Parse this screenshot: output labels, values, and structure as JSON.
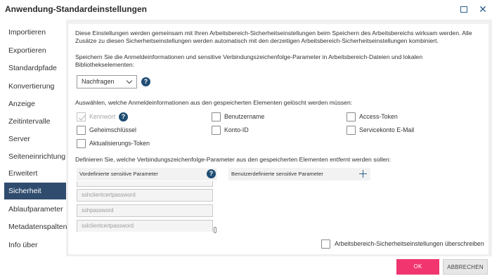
{
  "window": {
    "title": "Anwendung-Standardeinstellungen"
  },
  "sidebar": {
    "items": [
      {
        "label": "Importieren",
        "active": false
      },
      {
        "label": "Exportieren",
        "active": false
      },
      {
        "label": "Standardpfade",
        "active": false
      },
      {
        "label": "Konvertierung",
        "active": false
      },
      {
        "label": "Anzeige",
        "active": false
      },
      {
        "label": "Zeitintervalle",
        "active": false
      },
      {
        "label": "Server",
        "active": false
      },
      {
        "label": "Seiteneinrichtung",
        "active": false
      },
      {
        "label": "Erweitert",
        "active": false
      },
      {
        "label": "Sicherheit",
        "active": true
      },
      {
        "label": "Ablaufparameter",
        "active": false
      },
      {
        "label": "Metadatenspalten",
        "active": false
      },
      {
        "label": "Info über",
        "active": false
      }
    ]
  },
  "main": {
    "intro_line1": "Diese Einstellungen werden gemeinsam mit Ihren Arbeitsbereich-Sicherheitseinstellungen beim Speichern des Arbeitsbereichs wirksam werden.  Alle",
    "intro_line2": "Zusätze zu diesen Sicherheitseinstellungen werden automatisch mit den derzeitigen Arbeitsbereich-Sicherheitseinstellungen kombiniert.",
    "save_line1": "Speichern Sie die Anmeldeinformationen und sensitive Verbindungszeichenfolge-Parameter in Arbeitsbereich-Dateien und lokalen",
    "save_line2": "Bibliothekselementen:",
    "save_select_value": "Nachfragen",
    "credentials_prompt": "Auswählen, welche Anmeldeinformationen aus den gespeicherten Elementen gelöscht werden müssen:",
    "checkboxes": {
      "kennwort": {
        "label": "Kennwort",
        "checked": true,
        "disabled": true
      },
      "benutzername": {
        "label": "Benutzername",
        "checked": false
      },
      "access_token": {
        "label": "Access-Token",
        "checked": false
      },
      "geheimschluessel": {
        "label": "Geheimschlüssel",
        "checked": false
      },
      "konto_id": {
        "label": "Konto-ID",
        "checked": false
      },
      "servicekonto": {
        "label": "Servicekonto E-Mail",
        "checked": false
      },
      "aktualisierungs_token": {
        "label": "Aktualisierungs-Token",
        "checked": false
      }
    },
    "params_prompt": "Definieren Sie, welche Verbindungszeichenfolge-Parameter aus den gespeicherten Elementen entfernt werden sollen:",
    "predefined_header": "Vordefinierte sensitive Parameter",
    "custom_header": "Benutzerdefinierte sensitive Parameter",
    "predefined_params": [
      "sshclientcertpassword",
      "sshpassword",
      "sslclientcertpassword"
    ],
    "override_label": "Arbeitsbereich-Sicherheitseinstellungen überschreiben",
    "override_checked": false
  },
  "footer": {
    "ok_label": "OK",
    "cancel_label": "ABBRECHEN"
  },
  "colors": {
    "accent": "#f0356f",
    "nav_active": "#2f4c6e",
    "help_icon": "#1f4d74"
  }
}
